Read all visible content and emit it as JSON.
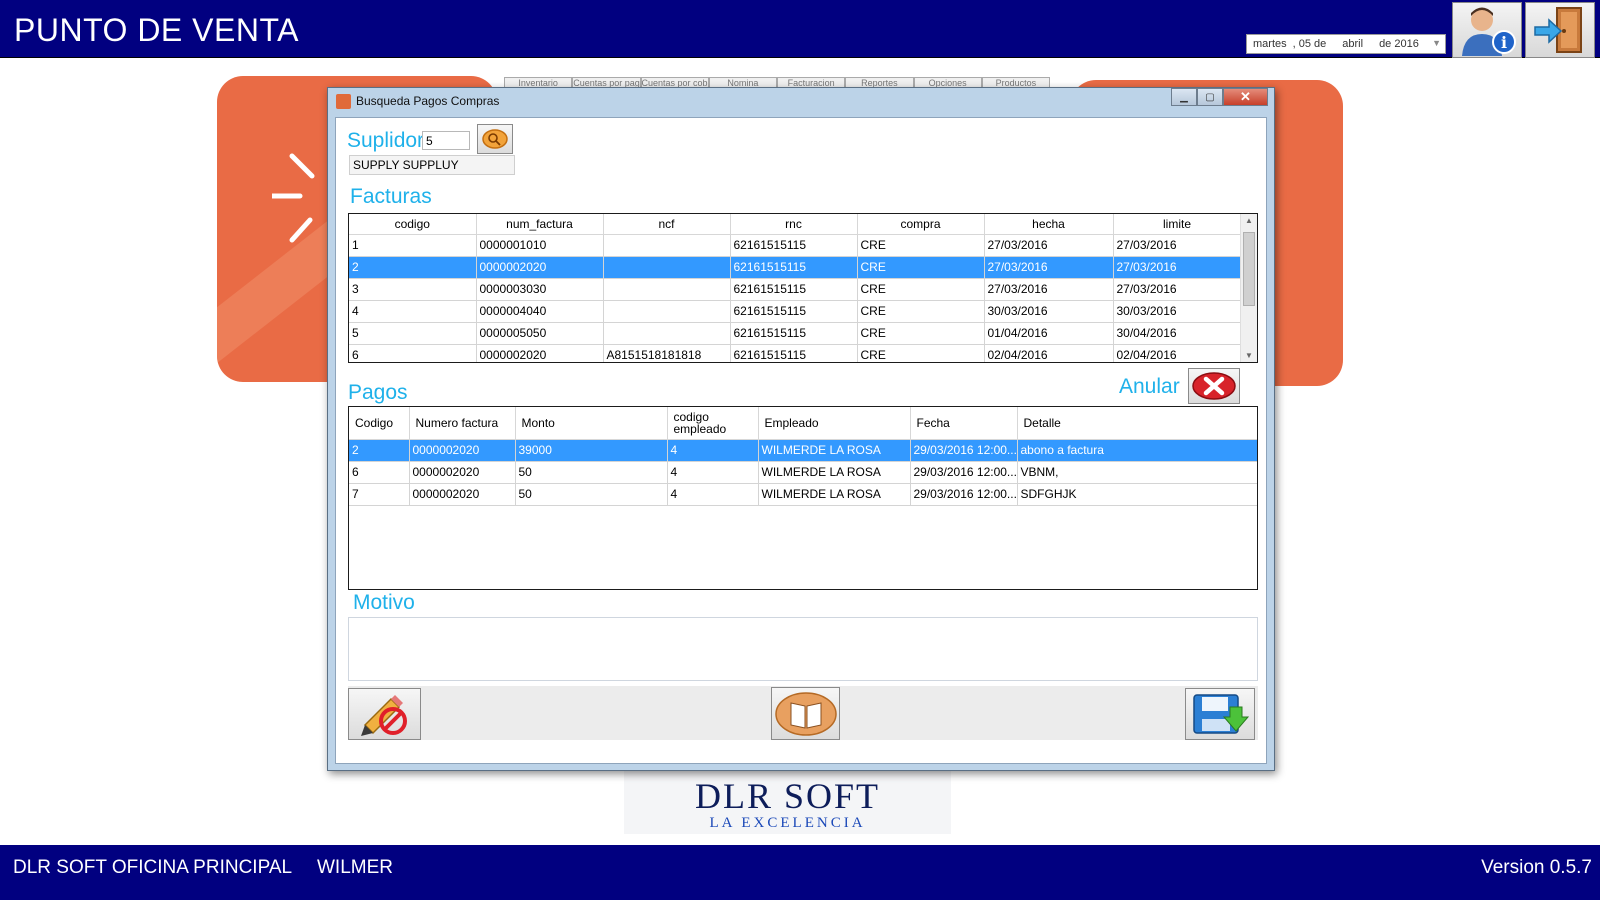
{
  "app": {
    "title": "PUNTO DE VENTA",
    "date": {
      "weekday": "martes",
      "day": ", 05 de",
      "month": "abril",
      "year": "de 2016"
    }
  },
  "background": {
    "tabs": [
      "Inventario",
      "Cuentas por pagar",
      "Cuentas por cobrar",
      "Nomina",
      "Facturacion",
      "Reportes",
      "Opciones",
      "Productos"
    ],
    "logo_title": "DLR SOFT",
    "logo_subtitle": "LA EXCELENCIA"
  },
  "status": {
    "office": "DLR SOFT OFICINA PRINCIPAL",
    "user": "WILMER",
    "version": "Version 0.5.7"
  },
  "dialog": {
    "title": "Busqueda Pagos Compras",
    "suplidor_label": "Suplidor",
    "suplidor_code": "5",
    "suplidor_name": "SUPPLY SUPPLUY",
    "facturas_label": "Facturas",
    "pagos_label": "Pagos",
    "anular_label": "Anular",
    "motivo_label": "Motivo",
    "motivo_value": ""
  },
  "facturas": {
    "columns": [
      "codigo",
      "num_factura",
      "ncf",
      "rnc",
      "compra",
      "hecha",
      "limite"
    ],
    "rows": [
      [
        "1",
        "0000001010",
        "",
        "62161515115",
        "CRE",
        "27/03/2016",
        "27/03/2016"
      ],
      [
        "2",
        "0000002020",
        "",
        "62161515115",
        "CRE",
        "27/03/2016",
        "27/03/2016"
      ],
      [
        "3",
        "0000003030",
        "",
        "62161515115",
        "CRE",
        "27/03/2016",
        "27/03/2016"
      ],
      [
        "4",
        "0000004040",
        "",
        "62161515115",
        "CRE",
        "30/03/2016",
        "30/03/2016"
      ],
      [
        "5",
        "0000005050",
        "",
        "62161515115",
        "CRE",
        "01/04/2016",
        "30/04/2016"
      ],
      [
        "6",
        "0000002020",
        "A8151518181818",
        "62161515115",
        "CRE",
        "02/04/2016",
        "02/04/2016"
      ]
    ],
    "selected_row": 1
  },
  "pagos": {
    "columns": [
      "Codigo",
      "Numero factura",
      "Monto",
      "codigo empleado",
      "Empleado",
      "Fecha",
      "Detalle"
    ],
    "rows": [
      [
        "2",
        "0000002020",
        "39000",
        "4",
        "WILMERDE LA ROSA",
        "29/03/2016 12:00...",
        "abono a factura"
      ],
      [
        "6",
        "0000002020",
        "50",
        "4",
        "WILMERDE LA ROSA",
        "29/03/2016 12:00...",
        "VBNM,"
      ],
      [
        "7",
        "0000002020",
        "50",
        "4",
        "WILMERDE LA ROSA",
        "29/03/2016 12:00...",
        "SDFGHJK"
      ]
    ],
    "selected_row": 0
  },
  "icons": {
    "user_info": "user-info-icon",
    "exit": "exit-door-icon",
    "search": "search-icon",
    "anular": "red-x-icon",
    "cancel": "pencil-cancel-icon",
    "open": "book-icon",
    "save": "save-disk-icon"
  },
  "colors": {
    "header": "#010080",
    "accent": "#1fb1ea",
    "selection": "#3399ff",
    "card": "#e96b45"
  }
}
